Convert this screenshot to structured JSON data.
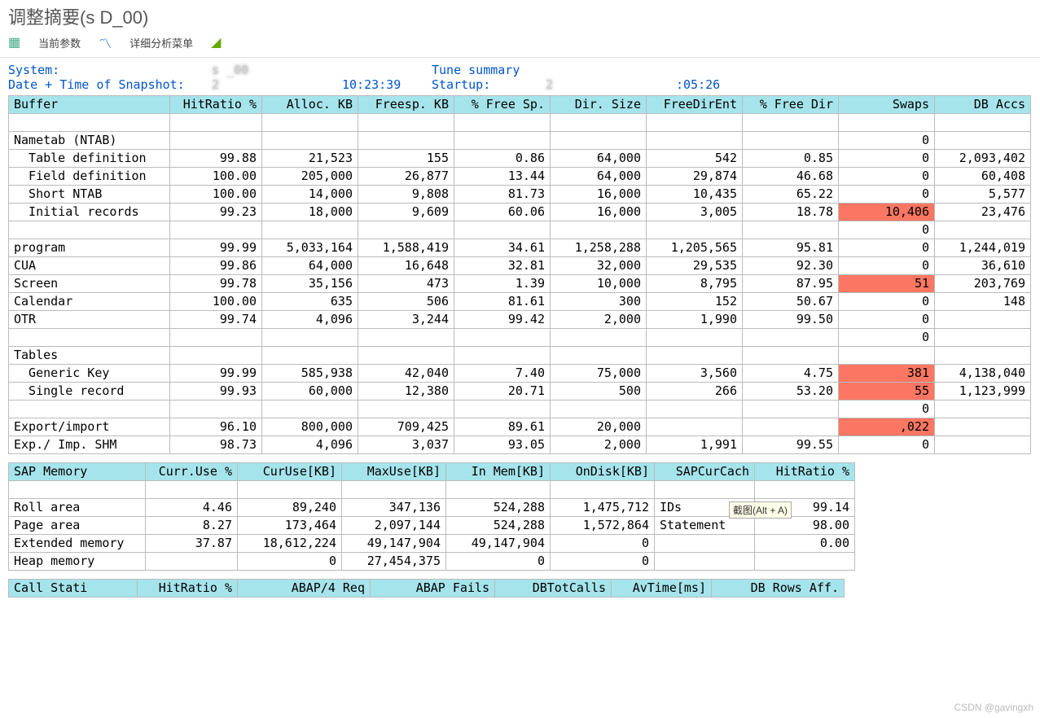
{
  "title": "调整摘要(s         D_00)",
  "toolbar": {
    "current_params": "当前参数",
    "detail_menu": "详细分析菜单"
  },
  "header": {
    "system_label": "System:",
    "system_value": "s         _00",
    "tune_summary": "Tune summary",
    "snap_label": "Date + Time of Snapshot:",
    "snap_date": "2",
    "snap_time": "10:23:39",
    "startup_label": "Startup:",
    "startup_date": "2",
    "startup_time": ":05:26"
  },
  "buffer_headers": [
    "Buffer",
    "HitRatio %",
    "Alloc. KB",
    "Freesp. KB",
    "% Free Sp.",
    "Dir. Size",
    "FreeDirEnt",
    "% Free Dir",
    "Swaps",
    "DB Accs"
  ],
  "buffer_rows": [
    {
      "label": "Nametab (NTAB)",
      "indent": 0,
      "vals": [
        "",
        "",
        "",
        "",
        "",
        "",
        "",
        "0",
        ""
      ]
    },
    {
      "label": "Table definition",
      "indent": 1,
      "vals": [
        "99.88",
        "21,523",
        "155",
        "0.86",
        "64,000",
        "542",
        "0.85",
        "0",
        "2,093,402"
      ]
    },
    {
      "label": "Field definition",
      "indent": 1,
      "vals": [
        "100.00",
        "205,000",
        "26,877",
        "13.44",
        "64,000",
        "29,874",
        "46.68",
        "0",
        "60,408"
      ]
    },
    {
      "label": "Short NTAB",
      "indent": 1,
      "vals": [
        "100.00",
        "14,000",
        "9,808",
        "81.73",
        "16,000",
        "10,435",
        "65.22",
        "0",
        "5,577"
      ]
    },
    {
      "label": "Initial records",
      "indent": 1,
      "vals": [
        "99.23",
        "18,000",
        "9,609",
        "60.06",
        "16,000",
        "3,005",
        "18.78",
        "10,406",
        "23,476"
      ],
      "hl": [
        7
      ]
    },
    {
      "label": "",
      "indent": 0,
      "vals": [
        "",
        "",
        "",
        "",
        "",
        "",
        "",
        "0",
        ""
      ]
    },
    {
      "label": "program",
      "indent": 0,
      "vals": [
        "99.99",
        "5,033,164",
        "1,588,419",
        "34.61",
        "1,258,288",
        "1,205,565",
        "95.81",
        "0",
        "1,244,019"
      ]
    },
    {
      "label": "CUA",
      "indent": 0,
      "vals": [
        "99.86",
        "64,000",
        "16,648",
        "32.81",
        "32,000",
        "29,535",
        "92.30",
        "0",
        "36,610"
      ]
    },
    {
      "label": "Screen",
      "indent": 0,
      "vals": [
        "99.78",
        "35,156",
        "473",
        "1.39",
        "10,000",
        "8,795",
        "87.95",
        "51",
        "203,769"
      ],
      "hl": [
        7
      ]
    },
    {
      "label": "Calendar",
      "indent": 0,
      "vals": [
        "100.00",
        "635",
        "506",
        "81.61",
        "300",
        "152",
        "50.67",
        "0",
        "148"
      ]
    },
    {
      "label": "OTR",
      "indent": 0,
      "vals": [
        "99.74",
        "4,096",
        "3,244",
        "99.42",
        "2,000",
        "1,990",
        "99.50",
        "0",
        ""
      ]
    },
    {
      "label": "",
      "indent": 0,
      "vals": [
        "",
        "",
        "",
        "",
        "",
        "",
        "",
        "0",
        ""
      ]
    },
    {
      "label": "Tables",
      "indent": 0,
      "vals": [
        "",
        "",
        "",
        "",
        "",
        "",
        "",
        "",
        ""
      ]
    },
    {
      "label": "Generic Key",
      "indent": 1,
      "vals": [
        "99.99",
        "585,938",
        "42,040",
        "7.40",
        "75,000",
        "3,560",
        "4.75",
        "381",
        "4,138,040"
      ],
      "hl": [
        7
      ]
    },
    {
      "label": "Single record",
      "indent": 1,
      "vals": [
        "99.93",
        "60,000",
        "12,380",
        "20.71",
        "500",
        "266",
        "53.20",
        "55",
        "1,123,999"
      ],
      "hl": [
        7
      ]
    },
    {
      "label": "",
      "indent": 0,
      "vals": [
        "",
        "",
        "",
        "",
        "",
        "",
        "",
        "0",
        ""
      ]
    },
    {
      "label": "Export/import",
      "indent": 0,
      "vals": [
        "96.10",
        "800,000",
        "709,425",
        "89.61",
        "20,000",
        "",
        "",
        "  ,022",
        ""
      ],
      "hl": [
        7
      ]
    },
    {
      "label": "Exp./ Imp. SHM",
      "indent": 0,
      "vals": [
        "98.73",
        "4,096",
        "3,037",
        "93.05",
        "2,000",
        "1,991",
        "99.55",
        "0",
        ""
      ]
    }
  ],
  "mem_headers": [
    "SAP Memory",
    "Curr.Use %",
    "CurUse[KB]",
    "MaxUse[KB]",
    "In Mem[KB]",
    "OnDisk[KB]",
    "SAPCurCach",
    "HitRatio %"
  ],
  "mem_rows": [
    {
      "label": "Roll area",
      "vals": [
        "4.46",
        "89,240",
        "347,136",
        "524,288",
        "1,475,712",
        "IDs",
        "99.14"
      ]
    },
    {
      "label": "Page area",
      "vals": [
        "8.27",
        "173,464",
        "2,097,144",
        "524,288",
        "1,572,864",
        "Statement",
        "98.00"
      ]
    },
    {
      "label": "Extended memory",
      "vals": [
        "37.87",
        "18,612,224",
        "49,147,904",
        "49,147,904",
        "0",
        "",
        "0.00"
      ]
    },
    {
      "label": "Heap memory",
      "vals": [
        "",
        "0",
        "27,454,375",
        "0",
        "0",
        "",
        ""
      ]
    }
  ],
  "call_headers": [
    "Call Stati",
    "HitRatio %",
    "ABAP/4 Req",
    "ABAP Fails",
    "DBTotCalls",
    "AvTime[ms]",
    "DB Rows Aff."
  ],
  "tooltip": "截图(Alt + A)",
  "watermark": "CSDN @gavingxh"
}
